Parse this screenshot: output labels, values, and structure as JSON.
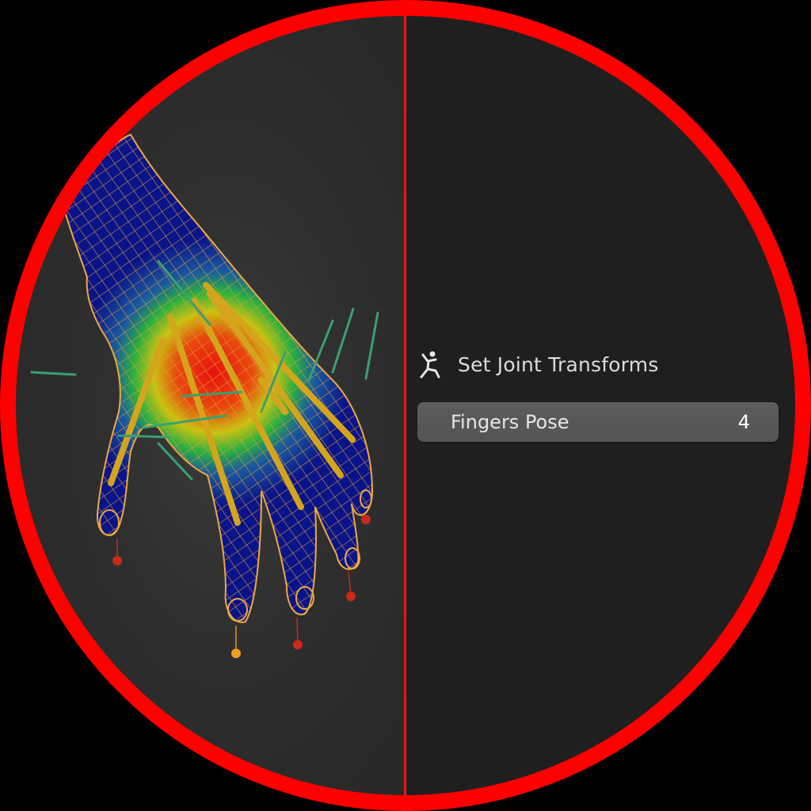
{
  "operator_panel": {
    "title": "Set Joint Transforms",
    "icon": "armature-pose-icon",
    "property": {
      "label": "Fingers Pose",
      "value": "4"
    }
  },
  "viewport": {
    "content": "weight-paint-hand-mesh-with-armature"
  },
  "colors": {
    "ring": "#ff0000",
    "divider": "#e8191b",
    "panel_bg": "#1f1f1f",
    "field_bg": "#595959",
    "bone_color": "#d4a51c",
    "wire_color": "#e8a030"
  }
}
